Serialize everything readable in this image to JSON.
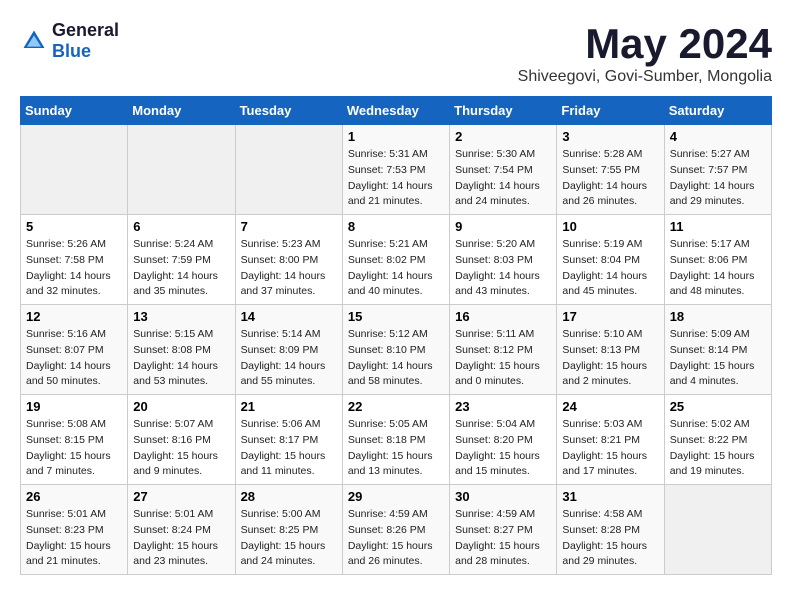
{
  "logo": {
    "text1": "General",
    "text2": "Blue"
  },
  "title": "May 2024",
  "subtitle": "Shiveegovi, Govi-Sumber, Mongolia",
  "days_of_week": [
    "Sunday",
    "Monday",
    "Tuesday",
    "Wednesday",
    "Thursday",
    "Friday",
    "Saturday"
  ],
  "weeks": [
    [
      {
        "day": "",
        "sunrise": "",
        "sunset": "",
        "daylight": ""
      },
      {
        "day": "",
        "sunrise": "",
        "sunset": "",
        "daylight": ""
      },
      {
        "day": "",
        "sunrise": "",
        "sunset": "",
        "daylight": ""
      },
      {
        "day": "1",
        "sunrise": "5:31 AM",
        "sunset": "7:53 PM",
        "daylight": "14 hours and 21 minutes."
      },
      {
        "day": "2",
        "sunrise": "5:30 AM",
        "sunset": "7:54 PM",
        "daylight": "14 hours and 24 minutes."
      },
      {
        "day": "3",
        "sunrise": "5:28 AM",
        "sunset": "7:55 PM",
        "daylight": "14 hours and 26 minutes."
      },
      {
        "day": "4",
        "sunrise": "5:27 AM",
        "sunset": "7:57 PM",
        "daylight": "14 hours and 29 minutes."
      }
    ],
    [
      {
        "day": "5",
        "sunrise": "5:26 AM",
        "sunset": "7:58 PM",
        "daylight": "14 hours and 32 minutes."
      },
      {
        "day": "6",
        "sunrise": "5:24 AM",
        "sunset": "7:59 PM",
        "daylight": "14 hours and 35 minutes."
      },
      {
        "day": "7",
        "sunrise": "5:23 AM",
        "sunset": "8:00 PM",
        "daylight": "14 hours and 37 minutes."
      },
      {
        "day": "8",
        "sunrise": "5:21 AM",
        "sunset": "8:02 PM",
        "daylight": "14 hours and 40 minutes."
      },
      {
        "day": "9",
        "sunrise": "5:20 AM",
        "sunset": "8:03 PM",
        "daylight": "14 hours and 43 minutes."
      },
      {
        "day": "10",
        "sunrise": "5:19 AM",
        "sunset": "8:04 PM",
        "daylight": "14 hours and 45 minutes."
      },
      {
        "day": "11",
        "sunrise": "5:17 AM",
        "sunset": "8:06 PM",
        "daylight": "14 hours and 48 minutes."
      }
    ],
    [
      {
        "day": "12",
        "sunrise": "5:16 AM",
        "sunset": "8:07 PM",
        "daylight": "14 hours and 50 minutes."
      },
      {
        "day": "13",
        "sunrise": "5:15 AM",
        "sunset": "8:08 PM",
        "daylight": "14 hours and 53 minutes."
      },
      {
        "day": "14",
        "sunrise": "5:14 AM",
        "sunset": "8:09 PM",
        "daylight": "14 hours and 55 minutes."
      },
      {
        "day": "15",
        "sunrise": "5:12 AM",
        "sunset": "8:10 PM",
        "daylight": "14 hours and 58 minutes."
      },
      {
        "day": "16",
        "sunrise": "5:11 AM",
        "sunset": "8:12 PM",
        "daylight": "15 hours and 0 minutes."
      },
      {
        "day": "17",
        "sunrise": "5:10 AM",
        "sunset": "8:13 PM",
        "daylight": "15 hours and 2 minutes."
      },
      {
        "day": "18",
        "sunrise": "5:09 AM",
        "sunset": "8:14 PM",
        "daylight": "15 hours and 4 minutes."
      }
    ],
    [
      {
        "day": "19",
        "sunrise": "5:08 AM",
        "sunset": "8:15 PM",
        "daylight": "15 hours and 7 minutes."
      },
      {
        "day": "20",
        "sunrise": "5:07 AM",
        "sunset": "8:16 PM",
        "daylight": "15 hours and 9 minutes."
      },
      {
        "day": "21",
        "sunrise": "5:06 AM",
        "sunset": "8:17 PM",
        "daylight": "15 hours and 11 minutes."
      },
      {
        "day": "22",
        "sunrise": "5:05 AM",
        "sunset": "8:18 PM",
        "daylight": "15 hours and 13 minutes."
      },
      {
        "day": "23",
        "sunrise": "5:04 AM",
        "sunset": "8:20 PM",
        "daylight": "15 hours and 15 minutes."
      },
      {
        "day": "24",
        "sunrise": "5:03 AM",
        "sunset": "8:21 PM",
        "daylight": "15 hours and 17 minutes."
      },
      {
        "day": "25",
        "sunrise": "5:02 AM",
        "sunset": "8:22 PM",
        "daylight": "15 hours and 19 minutes."
      }
    ],
    [
      {
        "day": "26",
        "sunrise": "5:01 AM",
        "sunset": "8:23 PM",
        "daylight": "15 hours and 21 minutes."
      },
      {
        "day": "27",
        "sunrise": "5:01 AM",
        "sunset": "8:24 PM",
        "daylight": "15 hours and 23 minutes."
      },
      {
        "day": "28",
        "sunrise": "5:00 AM",
        "sunset": "8:25 PM",
        "daylight": "15 hours and 24 minutes."
      },
      {
        "day": "29",
        "sunrise": "4:59 AM",
        "sunset": "8:26 PM",
        "daylight": "15 hours and 26 minutes."
      },
      {
        "day": "30",
        "sunrise": "4:59 AM",
        "sunset": "8:27 PM",
        "daylight": "15 hours and 28 minutes."
      },
      {
        "day": "31",
        "sunrise": "4:58 AM",
        "sunset": "8:28 PM",
        "daylight": "15 hours and 29 minutes."
      },
      {
        "day": "",
        "sunrise": "",
        "sunset": "",
        "daylight": ""
      }
    ]
  ],
  "labels": {
    "sunrise_prefix": "Sunrise: ",
    "sunset_prefix": "Sunset: ",
    "daylight_prefix": "Daylight: "
  }
}
